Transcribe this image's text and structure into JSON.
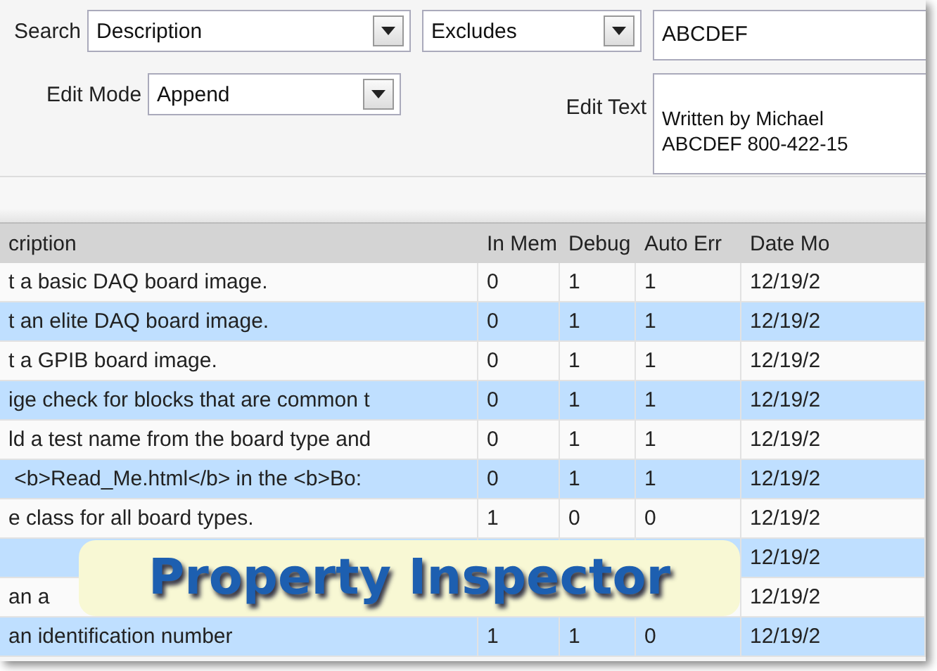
{
  "filters": {
    "search_label": "Search",
    "field": "Description",
    "operator": "Excludes",
    "value": "ABCDEF",
    "edit_mode_label": "Edit Mode",
    "edit_mode": "Append",
    "edit_text_label": "Edit Text",
    "edit_text": [
      "Written by Michael",
      "ABCDEF 800-422-15"
    ]
  },
  "table": {
    "columns": [
      "cription",
      "In Mem",
      "Debug",
      "Auto Err",
      "Date Mo"
    ],
    "rows": [
      {
        "cells": [
          "t a basic DAQ board image.",
          "0",
          "1",
          "1",
          "12/19/2"
        ]
      },
      {
        "cells": [
          "t an elite DAQ board image.",
          "0",
          "1",
          "1",
          "12/19/2"
        ]
      },
      {
        "cells": [
          "t a GPIB board image.",
          "0",
          "1",
          "1",
          "12/19/2"
        ]
      },
      {
        "cells": [
          "ige check for blocks that are common t",
          "0",
          "1",
          "1",
          "12/19/2"
        ]
      },
      {
        "cells": [
          "ld a test name from the board type and",
          "0",
          "1",
          "1",
          "12/19/2"
        ]
      },
      {
        "cells": [
          " <b>Read_Me.html</b> in the <b>Bo:",
          "0",
          "1",
          "1",
          "12/19/2"
        ]
      },
      {
        "cells": [
          "e class for all board types.",
          "1",
          "0",
          "0",
          "12/19/2"
        ]
      },
      {
        "cells": [
          "",
          "",
          "",
          "",
          "12/19/2"
        ]
      },
      {
        "cells": [
          "an a",
          "",
          "",
          "",
          "12/19/2"
        ]
      },
      {
        "cells": [
          "an identification number",
          "1",
          "1",
          "0",
          "12/19/2"
        ]
      }
    ]
  },
  "banner": {
    "title": "Property Inspector"
  }
}
